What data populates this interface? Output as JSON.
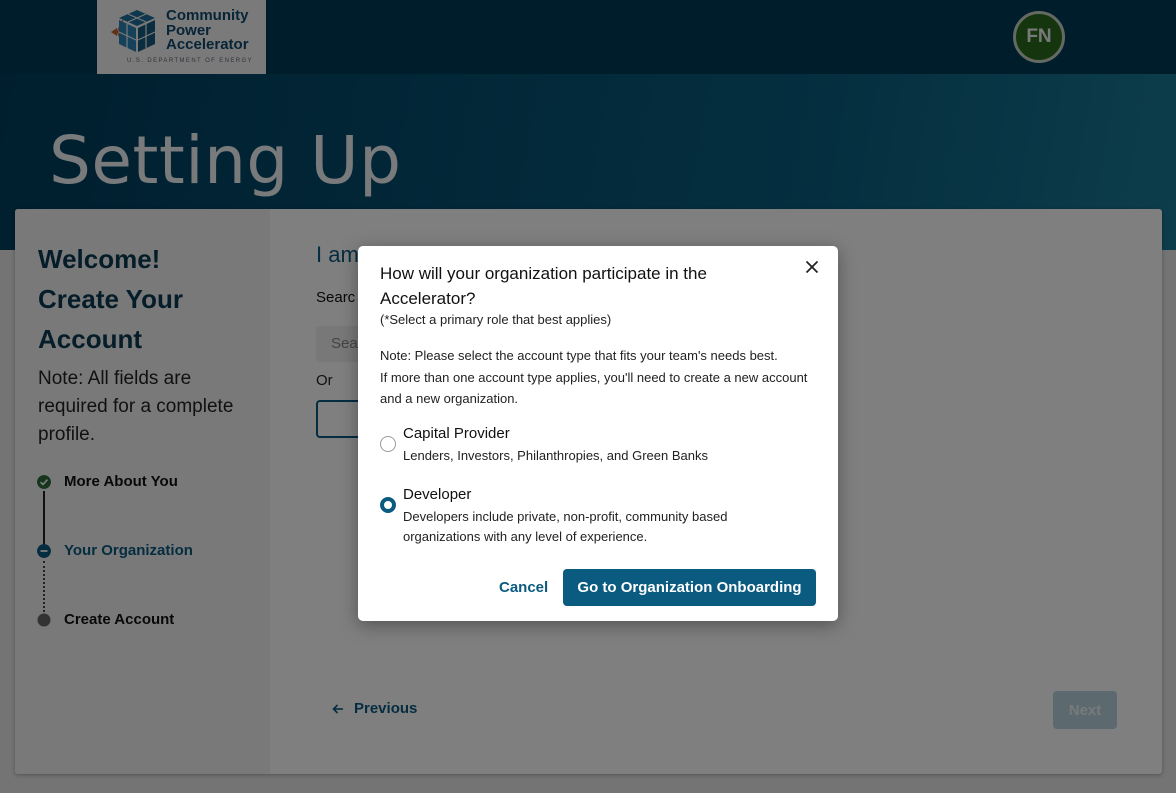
{
  "header": {
    "logo_line1": "Community",
    "logo_line2": "Power",
    "logo_line3": "Accelerator",
    "logo_sub": "U.S. DEPARTMENT OF ENERGY",
    "avatar_initials": "FN",
    "page_title": "Setting Up"
  },
  "sidebar": {
    "welcome_line1": "Welcome!",
    "welcome_line2": "Create Your",
    "welcome_line3": "Account",
    "note": "Note: All fields are required for a complete profile.",
    "steps": [
      {
        "label": "More About You",
        "status": "complete"
      },
      {
        "label": "Your Organization",
        "status": "current"
      },
      {
        "label": "Create Account",
        "status": "upcoming"
      }
    ]
  },
  "main": {
    "heading": "I am",
    "search_label": "Searc",
    "search_placeholder": "Sea",
    "or_text": "Or",
    "previous_label": "Previous",
    "next_label": "Next"
  },
  "modal": {
    "title": "How will your organization participate in the Accelerator?",
    "hint": "(*Select a primary role that best applies)",
    "note_line1": "Note: Please select the account type that fits your team's needs best.",
    "note_line2": "If more than one account type applies, you'll need to create a new account and a new organization.",
    "options": [
      {
        "title": "Capital Provider",
        "description": "Lenders, Investors, Philanthropies, and Green Banks",
        "selected": false
      },
      {
        "title": "Developer",
        "description": "Developers include private, non-profit, community based organizations with any level of experience.",
        "selected": true
      }
    ],
    "cancel_label": "Cancel",
    "confirm_label": "Go to Organization Onboarding"
  },
  "colors": {
    "brand_navy": "#003a57",
    "accent_blue": "#0b5a80",
    "avatar_green": "#2a6b1d",
    "step_complete": "#2f6b3a"
  }
}
